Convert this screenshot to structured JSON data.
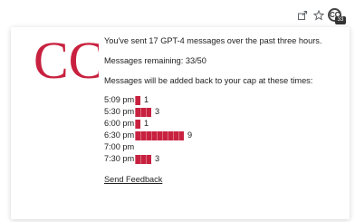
{
  "toolbar": {
    "icons": [
      "share-icon",
      "star-icon",
      "extension-icon"
    ],
    "extension_badge": "CC",
    "extension_count": "33"
  },
  "popup": {
    "logo_text": "CC",
    "sent_message": "You've sent 17 GPT-4 messages over the past three hours.",
    "remaining_message": "Messages remaining: 33/50",
    "added_back_message": "Messages will be added back to your cap at these times:",
    "schedule": [
      {
        "time": "5:09 pm",
        "count": 1
      },
      {
        "time": "5:30 pm",
        "count": 3
      },
      {
        "time": "6:00 pm",
        "count": 1
      },
      {
        "time": "6:30 pm",
        "count": 9
      },
      {
        "time": "7:00 pm",
        "count": 0
      },
      {
        "time": "7:30 pm",
        "count": 3
      }
    ],
    "feedback_link": "Send Feedback"
  },
  "colors": {
    "bar": "#c8213f",
    "logo": "#c8213f"
  }
}
